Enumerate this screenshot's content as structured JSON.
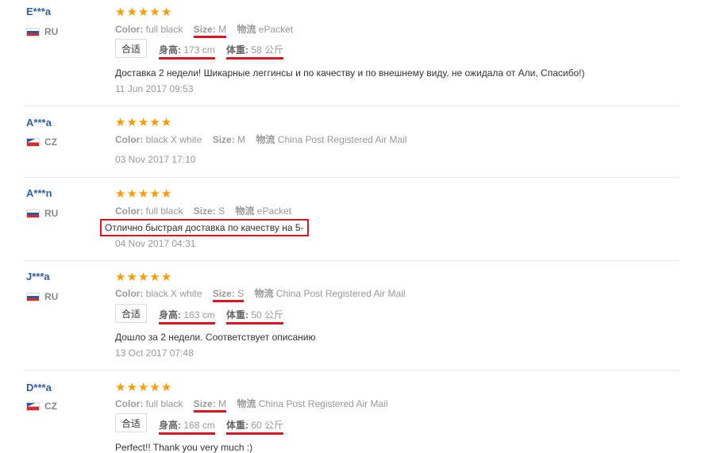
{
  "reviews": [
    {
      "buyer": "E***a",
      "country": "RU",
      "color_label": "Color:",
      "color": "full black",
      "size_label": "Size:",
      "size": "M",
      "logistics_label": "物流",
      "logistics": "ePacket",
      "fit": "合适",
      "height_label": "身高:",
      "height": "173 cm",
      "weight_label": "体重:",
      "weight": "58 公斤",
      "text": "Доставка 2 недели! Шикарные леггинсы и по качеству и по внешнему виду, не ожидала от Али, Спасибо!)",
      "date": "11 Jun 2017 09:53"
    },
    {
      "buyer": "A***a",
      "country": "CZ",
      "color_label": "Color:",
      "color": "black X white",
      "size_label": "Size:",
      "size": "M",
      "logistics_label": "物流",
      "logistics": "China Post Registered Air Mail",
      "date": "03 Nov 2017 17:10"
    },
    {
      "buyer": "A***n",
      "country": "RU",
      "color_label": "Color:",
      "color": "full black",
      "size_label": "Size:",
      "size": "S",
      "logistics_label": "物流",
      "logistics": "ePacket",
      "text": "Отлично быстрая доставка по качеству на 5-",
      "date": "04 Nov 2017 04:31"
    },
    {
      "buyer": "J***a",
      "country": "RU",
      "color_label": "Color:",
      "color": "black X white",
      "size_label": "Size:",
      "size": "S",
      "logistics_label": "物流",
      "logistics": "China Post Registered Air Mail",
      "fit": "合适",
      "height_label": "身高:",
      "height": "163 cm",
      "weight_label": "体重:",
      "weight": "50 公斤",
      "text": "Дошло за 2 недели. Соответствует описанию",
      "date": "13 Oct 2017 07:48"
    },
    {
      "buyer": "D***a",
      "country": "CZ",
      "color_label": "Color:",
      "color": "full black",
      "size_label": "Size:",
      "size": "M",
      "logistics_label": "物流",
      "logistics": "China Post Registered Air Mail",
      "fit": "合适",
      "height_label": "身高:",
      "height": "168 cm",
      "weight_label": "体重:",
      "weight": "60 公斤",
      "text": "Perfect!! Thank you very much :)"
    }
  ],
  "rating_stars": 5,
  "colors": {
    "name": "#2d5fa5",
    "star": "#ff9a00",
    "highlight": "#e0141e"
  }
}
